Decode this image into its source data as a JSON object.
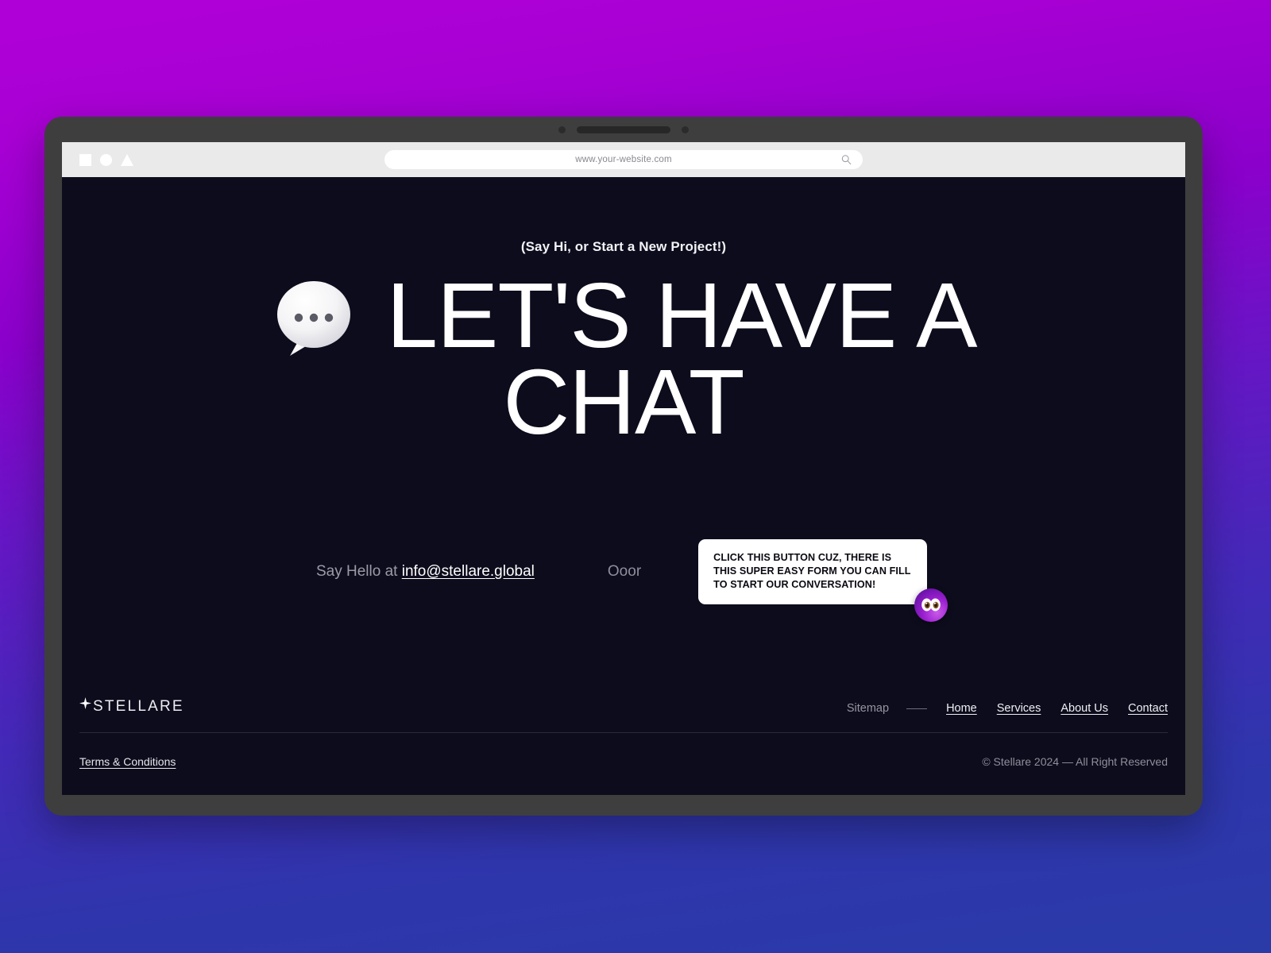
{
  "browser": {
    "window_shapes": [
      "square",
      "circle",
      "triangle"
    ],
    "url": "www.your-website.com",
    "search_icon": "search-icon"
  },
  "hero": {
    "eyebrow": "(Say Hi, or Start a New Project!)",
    "headline_line1": "LET'S HAVE A",
    "headline_line2": "CHAT",
    "bubble_icon": "speech-bubble-emoji"
  },
  "contact": {
    "say_hello_prefix": "Say Hello at",
    "email": "info@stellare.global",
    "separator": "Ooor",
    "tooltip": "CLICK THIS BUTTON CUZ, THERE IS THIS SUPER EASY FORM YOU CAN FILL TO START OUR CONVERSATION!",
    "badge_icon": "eyes-emoji"
  },
  "footer": {
    "logo_text": "STELLARE",
    "logo_icon": "sparkle-star-icon",
    "sitemap_label": "Sitemap",
    "nav": [
      {
        "label": "Home"
      },
      {
        "label": "Services"
      },
      {
        "label": "About Us"
      },
      {
        "label": "Contact"
      }
    ],
    "terms": "Terms & Conditions",
    "copyright": "© Stellare 2024 — All Right Reserved"
  },
  "colors": {
    "bg_gradient_top": "#b000d8",
    "bg_gradient_bottom": "#2a3ba8",
    "screen_bg": "#0c0c1c",
    "frame": "#3e3e3e",
    "accent_purple": "#9b1fd0"
  }
}
